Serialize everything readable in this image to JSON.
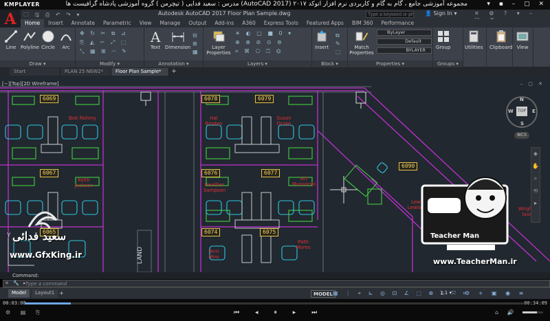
{
  "player": {
    "name": "KMPLAYER",
    "title": "مجموعه آموزشی جامع ، گام به گام و کاربردی نرم افزار  اتوکد ۲۰۱۷ (AutoCAD 2017)  مدرس : سعید فدایی ( تیچرمن ) گروه آموزشی پادشاه گرافیست ها",
    "time_current": "00:03:08",
    "time_total": "00:34:09",
    "progress": 0.092,
    "volume": 0.7
  },
  "app": {
    "logo": "A",
    "doc_title": "Autodesk AutoCAD 2017    Floor Plan Sample.dwg",
    "search_placeholder": "Type a keyword or phrase",
    "signin": "Sign In"
  },
  "ribbon_tabs": [
    "Home",
    "Insert",
    "Annotate",
    "Parametric",
    "View",
    "Manage",
    "Output",
    "Add-ins",
    "A360",
    "Express Tools",
    "Featured Apps",
    "BIM 360",
    "Performance"
  ],
  "ribbon": {
    "draw": {
      "label": "Draw ▾",
      "tools": [
        "Line",
        "Polyline",
        "Circle",
        "Arc"
      ]
    },
    "modify": {
      "label": "Modify ▾"
    },
    "annotation": {
      "label": "Annotation ▾",
      "tools": [
        "Text",
        "Dimension"
      ]
    },
    "layers": {
      "label": "Layers ▾",
      "tool": "Layer Properties"
    },
    "block": {
      "label": "Block ▾",
      "tool": "Insert"
    },
    "properties": {
      "label": "Properties ▾",
      "tool": "Match Properties",
      "color": "ByLayer",
      "linetype": "Default",
      "lineweight": "BYLAYER"
    },
    "groups": {
      "label": "Groups ▾",
      "tool": "Group"
    },
    "utilities": {
      "tool": "Utilities"
    },
    "clipboard": {
      "tool": "Clipboard"
    },
    "view": {
      "tool": "View"
    }
  },
  "file_tabs": [
    "Start",
    "PLAN 25 NEW2*",
    "Floor Plan Sample*"
  ],
  "viewport_label": "[−][Top][2D Wireframe]",
  "viewcube": {
    "top": "TOP",
    "n": "N",
    "s": "S",
    "e": "E",
    "w": "W",
    "wcs": "WCS"
  },
  "rooms": [
    {
      "number": "6069",
      "occupant": "Bob Rohmy"
    },
    {
      "number": "6078",
      "occupant": "Hal Broden"
    },
    {
      "number": "6079",
      "occupant": "Susan Drake"
    },
    {
      "number": "6067",
      "occupant": "Keith Jackson"
    },
    {
      "number": "6076",
      "occupant": "Heather Sampson"
    },
    {
      "number": "6077",
      "occupant": "Art Mussorski"
    },
    {
      "number": "6090",
      "occupant": "Lew Lewlon"
    },
    {
      "number": "6065",
      "occupant": ""
    },
    {
      "number": "6074",
      "occupant": "Terri Miro"
    },
    {
      "number": "6075",
      "occupant": "Patti Mores"
    }
  ],
  "partial_label": "Wrights tson",
  "land_label": "LAND",
  "ucs_y": "Y",
  "watermarks": {
    "left_name": "سعید فدائی",
    "left_site": "www.GfxKing.ir",
    "right_site": "www.TeacherMan.ir",
    "right_badge": "Teacher Man"
  },
  "command": {
    "history": "Command:",
    "placeholder": "Type a command"
  },
  "layout_tabs": [
    "Model",
    "Layout1"
  ],
  "status": {
    "model": "MODEL",
    "scale": "1:1 ▾"
  },
  "colors": {
    "accent": "#d22222",
    "ribbon_bg": "#3c414a",
    "canvas_bg": "#212830",
    "tag_yellow": "#e6c34a",
    "wall_magenta": "#c030d0",
    "furniture_cyan": "#30c8e0",
    "furniture_green": "#40c040",
    "occupant_red": "#e23030"
  }
}
